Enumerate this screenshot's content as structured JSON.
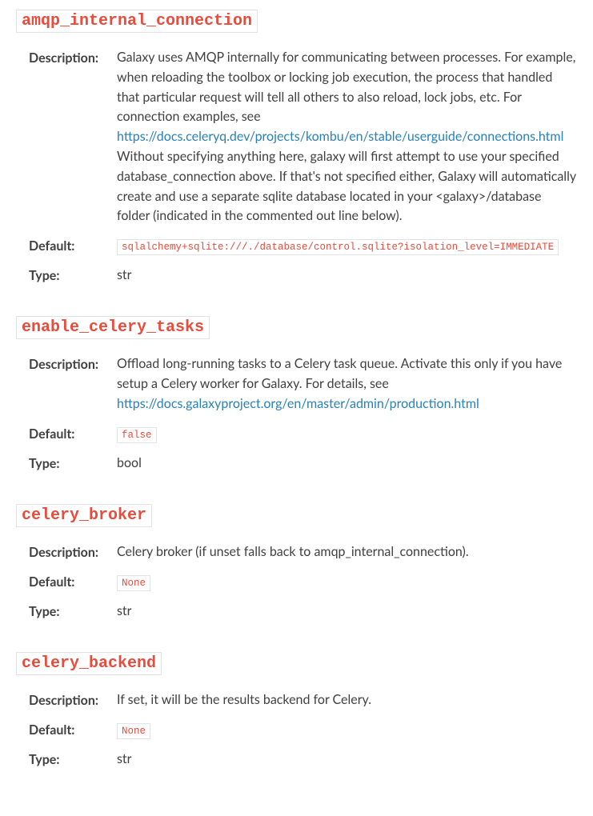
{
  "labels": {
    "description": "Description:",
    "default": "Default:",
    "type": "Type:"
  },
  "sections": [
    {
      "id": "amqp_internal_connection",
      "heading": "amqp_internal_connection",
      "description_pre": "Galaxy uses AMQP internally for communicating between processes. For example, when reloading the toolbox or locking job execution, the process that handled that particular request will tell all others to also reload, lock jobs, etc. For connection examples, see ",
      "description_link": "https://docs.celeryq.dev/projects/kombu/en/stable/userguide/connections.html",
      "description_linktext": "https://docs.celeryq.dev/projects/kombu/en/stable/userguide/connections.html",
      "description_post": " Without specifying anything here, galaxy will first attempt to use your specified database_connection above. If that's not specified either, Galaxy will automatically create and use a separate sqlite database located in your <galaxy>/database folder (indicated in the commented out line below).",
      "default": "sqlalchemy+sqlite:///./database/control.sqlite?isolation_level=IMMEDIATE",
      "type": "str"
    },
    {
      "id": "enable_celery_tasks",
      "heading": "enable_celery_tasks",
      "description_pre": "Offload long-running tasks to a Celery task queue. Activate this only if you have setup a Celery worker for Galaxy. For details, see ",
      "description_link": "https://docs.galaxyproject.org/en/master/admin/production.html",
      "description_linktext": "https://docs.galaxyproject.org/en/master/admin/production.html",
      "description_post": "",
      "default": "false",
      "type": "bool"
    },
    {
      "id": "celery_broker",
      "heading": "celery_broker",
      "description_pre": "Celery broker (if unset falls back to amqp_internal_connection).",
      "description_link": "",
      "description_linktext": "",
      "description_post": "",
      "default": "None",
      "type": "str"
    },
    {
      "id": "celery_backend",
      "heading": "celery_backend",
      "description_pre": "If set, it will be the results backend for Celery.",
      "description_link": "",
      "description_linktext": "",
      "description_post": "",
      "default": "None",
      "type": "str"
    }
  ]
}
